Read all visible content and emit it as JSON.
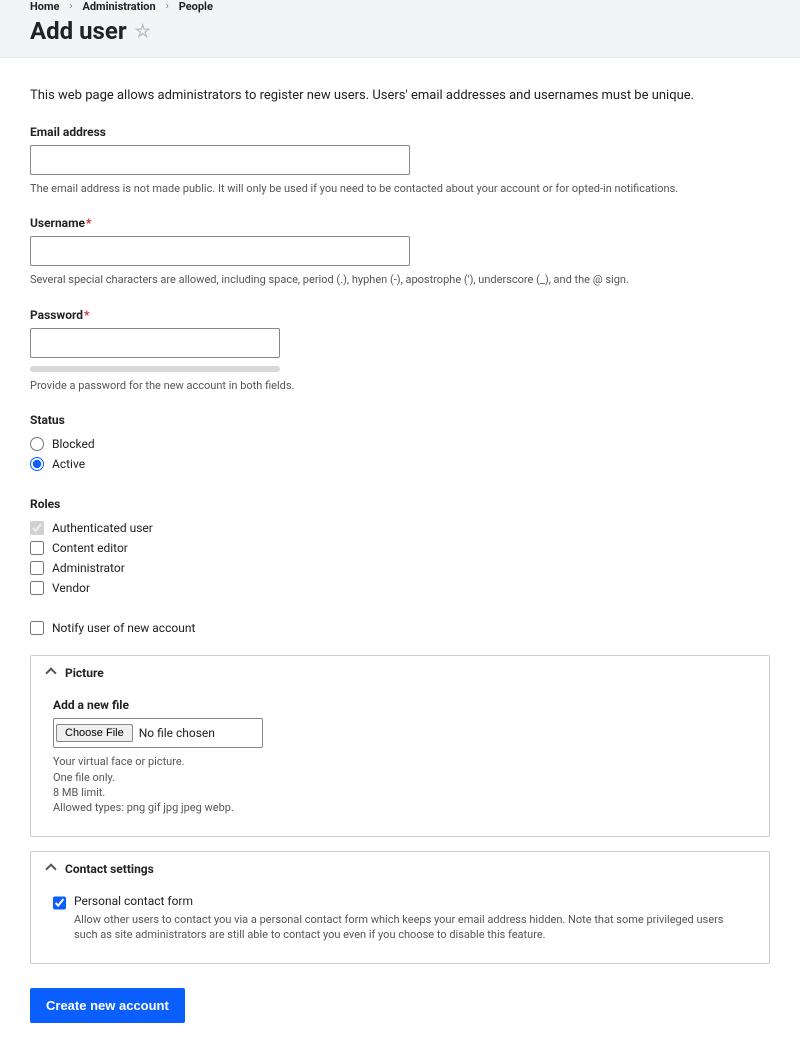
{
  "breadcrumb": {
    "home": "Home",
    "admin": "Administration",
    "people": "People"
  },
  "page_title": "Add user",
  "intro": "This web page allows administrators to register new users. Users' email addresses and usernames must be unique.",
  "email": {
    "label": "Email address",
    "help": "The email address is not made public. It will only be used if you need to be contacted about your account or for opted-in notifications.",
    "value": ""
  },
  "username": {
    "label": "Username",
    "help": "Several special characters are allowed, including space, period (.), hyphen (-), apostrophe ('), underscore (_), and the @ sign.",
    "value": ""
  },
  "password": {
    "label": "Password",
    "help": "Provide a password for the new account in both fields.",
    "value": ""
  },
  "status": {
    "legend": "Status",
    "options": {
      "blocked": "Blocked",
      "active": "Active"
    },
    "selected": "active"
  },
  "roles": {
    "legend": "Roles",
    "options": {
      "auth": "Authenticated user",
      "editor": "Content editor",
      "admin": "Administrator",
      "vendor": "Vendor"
    }
  },
  "notify": {
    "label": "Notify user of new account"
  },
  "picture": {
    "title": "Picture",
    "add_label": "Add a new file",
    "choose_btn": "Choose File",
    "no_file": "No file chosen",
    "help1": "Your virtual face or picture.",
    "help2": "One file only.",
    "help3": "8 MB limit.",
    "help4": "Allowed types: png gif jpg jpeg webp."
  },
  "contact": {
    "title": "Contact settings",
    "checkbox_label": "Personal contact form",
    "help": "Allow other users to contact you via a personal contact form which keeps your email address hidden. Note that some privileged users such as site administrators are still able to contact you even if you choose to disable this feature."
  },
  "submit": "Create new account"
}
